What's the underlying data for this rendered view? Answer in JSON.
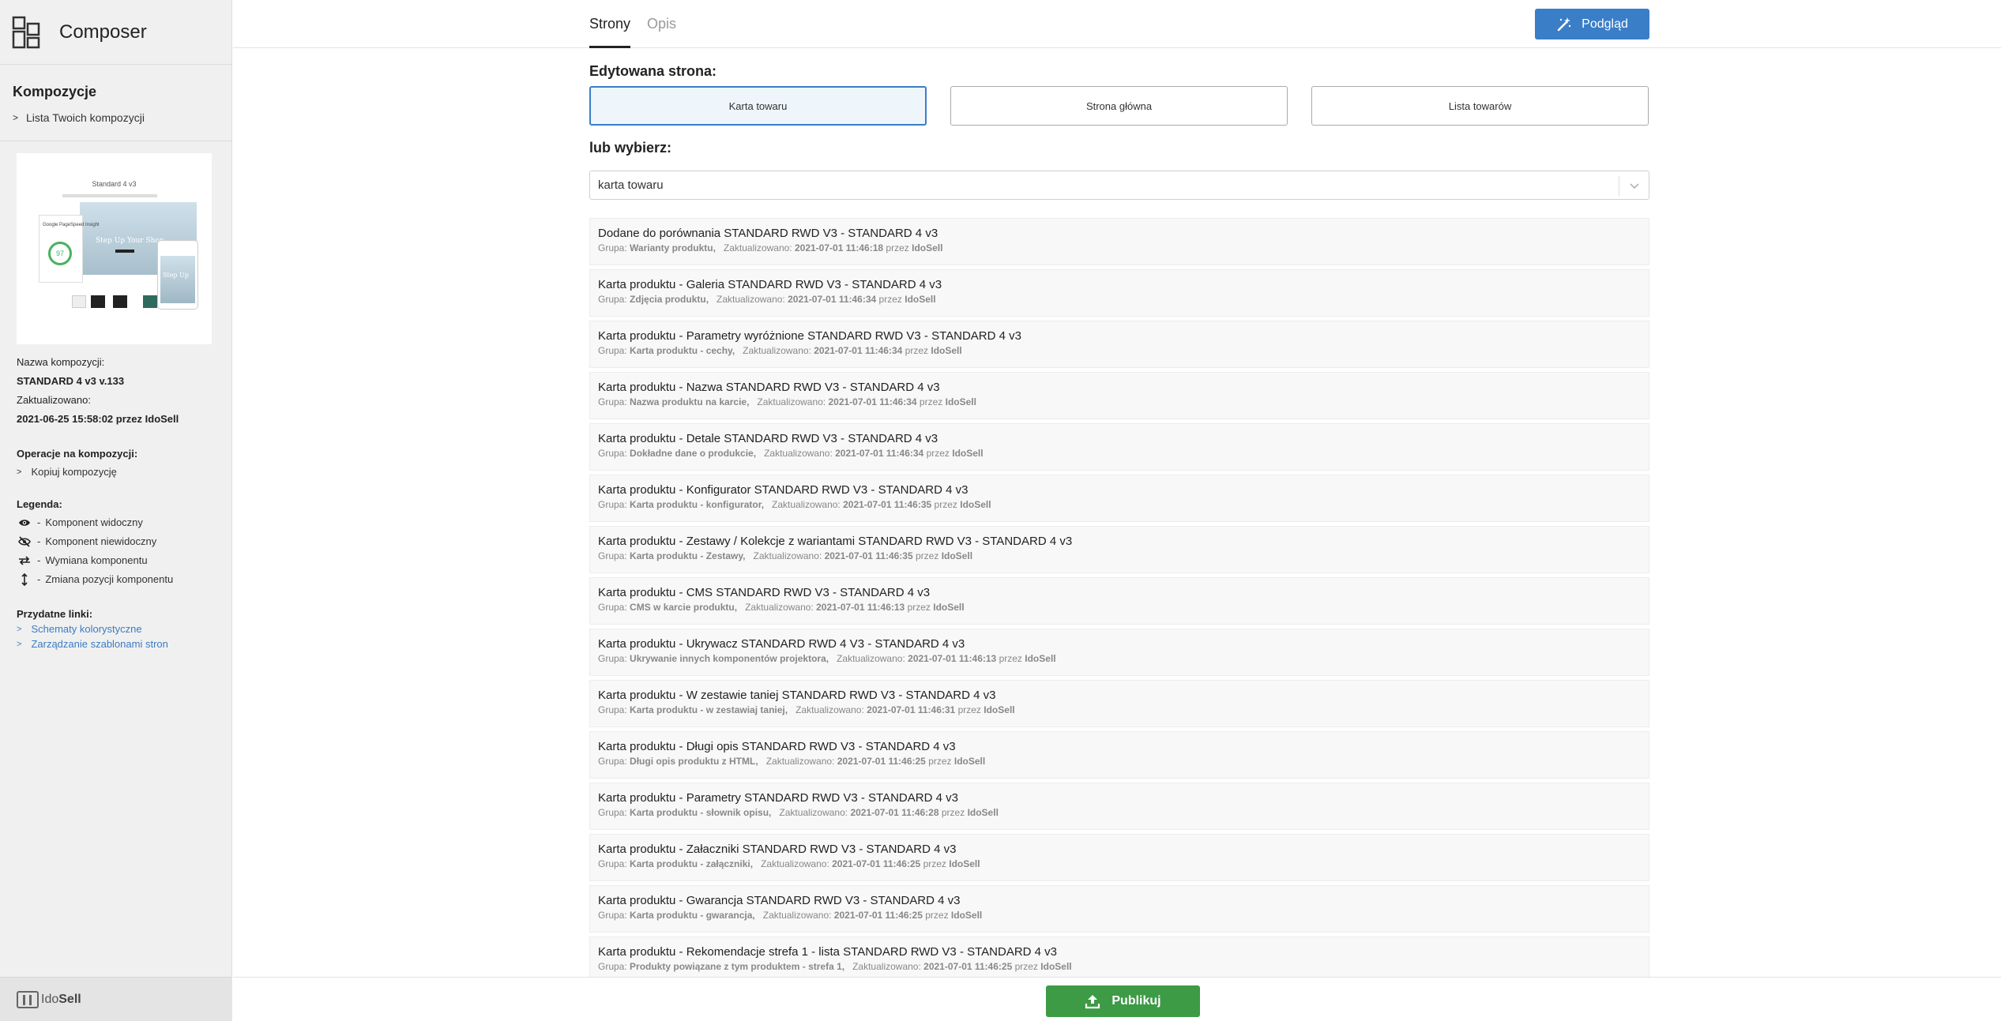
{
  "app": {
    "title": "Composer"
  },
  "sidebar": {
    "compositions_heading": "Kompozycje",
    "list_link": "Lista Twoich kompozycji",
    "thumbnail": {
      "title": "Standard 4 v3",
      "hero_text": "Step Up Your Shop",
      "card_label": "Google PageSpeed Insight",
      "score": "97",
      "phone_text": "Step Up"
    },
    "name_label": "Nazwa kompozycji:",
    "name_value": "STANDARD 4 v3 v.133",
    "updated_label": "Zaktualizowano:",
    "updated_value": "2021-06-25 15:58:02",
    "updated_by_prefix": "przez",
    "updated_by": "IdoSell",
    "operations_heading": "Operacje na kompozycji:",
    "copy_link": "Kopiuj kompozycję",
    "legend_heading": "Legenda:",
    "legend": [
      {
        "icon": "eye-icon",
        "label": "Komponent widoczny"
      },
      {
        "icon": "eye-slash-icon",
        "label": "Komponent niewidoczny"
      },
      {
        "icon": "swap-icon",
        "label": "Wymiana komponentu"
      },
      {
        "icon": "vertical-arrows-icon",
        "label": "Zmiana pozycji komponentu"
      }
    ],
    "links_heading": "Przydatne linki:",
    "links": [
      "Schematy kolorystyczne",
      "Zarządzanie szablonami stron"
    ],
    "footer_brand": {
      "prefix": "Ido",
      "bold": "Sell"
    }
  },
  "tabs": [
    {
      "label": "Strony",
      "active": true
    },
    {
      "label": "Opis",
      "active": false
    }
  ],
  "preview_button": "Podgląd",
  "edited_page_label": "Edytowana strona:",
  "page_buttons": [
    {
      "label": "Karta towaru",
      "selected": true
    },
    {
      "label": "Strona główna",
      "selected": false
    },
    {
      "label": "Lista towarów",
      "selected": false
    }
  ],
  "choose_label": "lub wybierz:",
  "select_value": "karta towaru",
  "meta_labels": {
    "group": "Grupa:",
    "updated": "Zaktualizowano:",
    "by": "przez"
  },
  "components": [
    {
      "title": "Dodane do porównania STANDARD RWD V3 - STANDARD 4 v3",
      "group": "Warianty produktu,",
      "updated": "2021-07-01 11:46:18",
      "by": "IdoSell"
    },
    {
      "title": "Karta produktu - Galeria STANDARD RWD V3 - STANDARD 4 v3",
      "group": "Zdjęcia produktu,",
      "updated": "2021-07-01 11:46:34",
      "by": "IdoSell"
    },
    {
      "title": "Karta produktu - Parametry wyróżnione STANDARD RWD V3 - STANDARD 4 v3",
      "group": "Karta produktu - cechy,",
      "updated": "2021-07-01 11:46:34",
      "by": "IdoSell"
    },
    {
      "title": "Karta produktu - Nazwa STANDARD RWD V3 - STANDARD 4 v3",
      "group": "Nazwa produktu na karcie,",
      "updated": "2021-07-01 11:46:34",
      "by": "IdoSell"
    },
    {
      "title": "Karta produktu - Detale STANDARD RWD V3 - STANDARD 4 v3",
      "group": "Dokładne dane o produkcie,",
      "updated": "2021-07-01 11:46:34",
      "by": "IdoSell"
    },
    {
      "title": "Karta produktu - Konfigurator STANDARD RWD V3 - STANDARD 4 v3",
      "group": "Karta produktu - konfigurator,",
      "updated": "2021-07-01 11:46:35",
      "by": "IdoSell"
    },
    {
      "title": "Karta produktu - Zestawy / Kolekcje z wariantami STANDARD RWD V3 - STANDARD 4 v3",
      "group": "Karta produktu - Zestawy,",
      "updated": "2021-07-01 11:46:35",
      "by": "IdoSell"
    },
    {
      "title": "Karta produktu - CMS STANDARD RWD V3 - STANDARD 4 v3",
      "group": "CMS w karcie produktu,",
      "updated": "2021-07-01 11:46:13",
      "by": "IdoSell"
    },
    {
      "title": "Karta produktu - Ukrywacz STANDARD RWD 4 V3 - STANDARD 4 v3",
      "group": "Ukrywanie innych komponentów projektora,",
      "updated": "2021-07-01 11:46:13",
      "by": "IdoSell"
    },
    {
      "title": "Karta produktu - W zestawie taniej STANDARD RWD V3 - STANDARD 4 v3",
      "group": "Karta produktu - w zestawiaj taniej,",
      "updated": "2021-07-01 11:46:31",
      "by": "IdoSell"
    },
    {
      "title": "Karta produktu - Długi opis STANDARD RWD V3 - STANDARD 4 v3",
      "group": "Długi opis produktu z HTML,",
      "updated": "2021-07-01 11:46:25",
      "by": "IdoSell"
    },
    {
      "title": "Karta produktu - Parametry STANDARD RWD V3 - STANDARD 4 v3",
      "group": "Karta produktu - słownik opisu,",
      "updated": "2021-07-01 11:46:28",
      "by": "IdoSell"
    },
    {
      "title": "Karta produktu - Załaczniki STANDARD RWD V3 - STANDARD 4 v3",
      "group": "Karta produktu - załączniki,",
      "updated": "2021-07-01 11:46:25",
      "by": "IdoSell"
    },
    {
      "title": "Karta produktu - Gwarancja STANDARD RWD V3 - STANDARD 4 v3",
      "group": "Karta produktu - gwarancja,",
      "updated": "2021-07-01 11:46:25",
      "by": "IdoSell"
    },
    {
      "title": "Karta produktu - Rekomendacje strefa 1 - lista STANDARD RWD V3 - STANDARD 4 v3",
      "group": "Produkty powiązane z tym produktem - strefa 1,",
      "updated": "2021-07-01 11:46:25",
      "by": "IdoSell"
    }
  ],
  "publish_button": "Publikuj",
  "colors": {
    "accent": "#3a7ec7",
    "publish": "#3d9a45",
    "link": "#3a7cc3",
    "score": "#46b35d"
  }
}
